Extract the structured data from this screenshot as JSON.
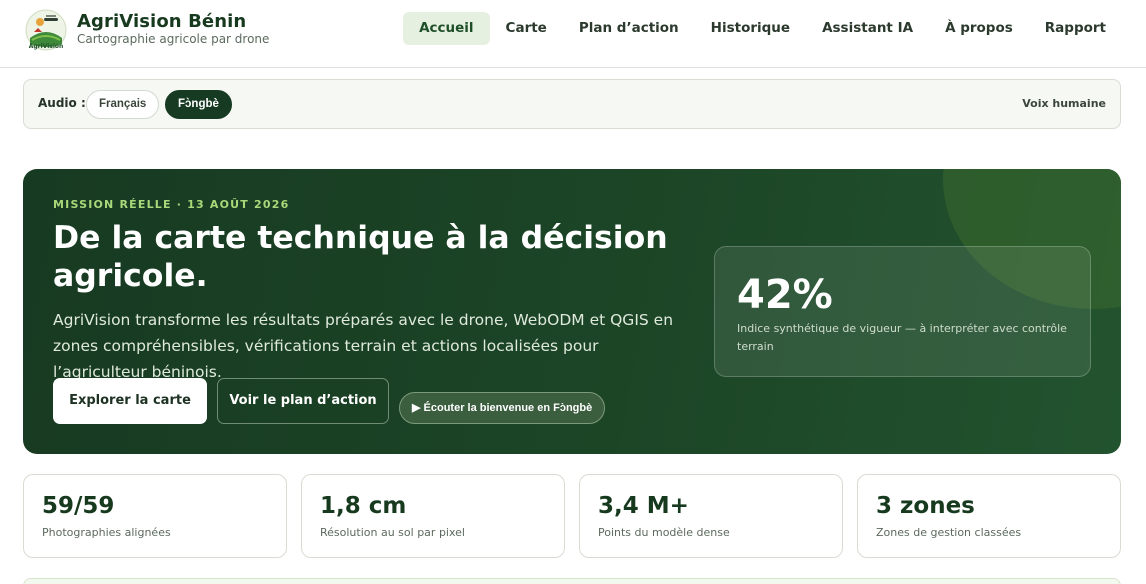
{
  "brand": {
    "title": "AgriVision Bénin",
    "subtitle": "Cartographie agricole par drone",
    "logo_text": "AgriVision"
  },
  "nav": {
    "items": [
      {
        "label": "Accueil",
        "active": true
      },
      {
        "label": "Carte",
        "active": false
      },
      {
        "label": "Plan d’action",
        "active": false
      },
      {
        "label": "Historique",
        "active": false
      },
      {
        "label": "Assistant IA",
        "active": false
      },
      {
        "label": "À propos",
        "active": false
      },
      {
        "label": "Rapport",
        "active": false
      }
    ]
  },
  "audio": {
    "label": "Audio :",
    "options": [
      "Français",
      "Fɔ̀ngbè"
    ],
    "selected": "Fɔ̀ngbè",
    "voice_label": "Voix humaine"
  },
  "hero": {
    "kicker": "MISSION RÉELLE · 13 AOÛT 2026",
    "title": "De la carte technique à la décision agricole.",
    "description": "AgriVision transforme les résultats préparés avec le drone, WebODM et QGIS en zones compréhensibles, vérifications terrain et actions localisées pour l’agriculteur béninois.",
    "primary_button": "Explorer la carte",
    "secondary_button": "Voir le plan d’action",
    "audio_button": "▶ Écouter la bienvenue en Fɔ̀ngbè",
    "stat": {
      "value": "42%",
      "label": "Indice synthétique de vigueur — à interpréter avec contrôle terrain"
    }
  },
  "metrics": [
    {
      "value": "59/59",
      "label": "Photographies alignées"
    },
    {
      "value": "1,8 cm",
      "label": "Résolution au sol par pixel"
    },
    {
      "value": "3,4 M+",
      "label": "Points du modèle dense"
    },
    {
      "value": "3 zones",
      "label": "Zones de gestion classées"
    }
  ],
  "colors": {
    "brand_dark": "#173a22",
    "accent_green": "#a8d87a",
    "nav_active_bg": "#e6f0e1"
  }
}
